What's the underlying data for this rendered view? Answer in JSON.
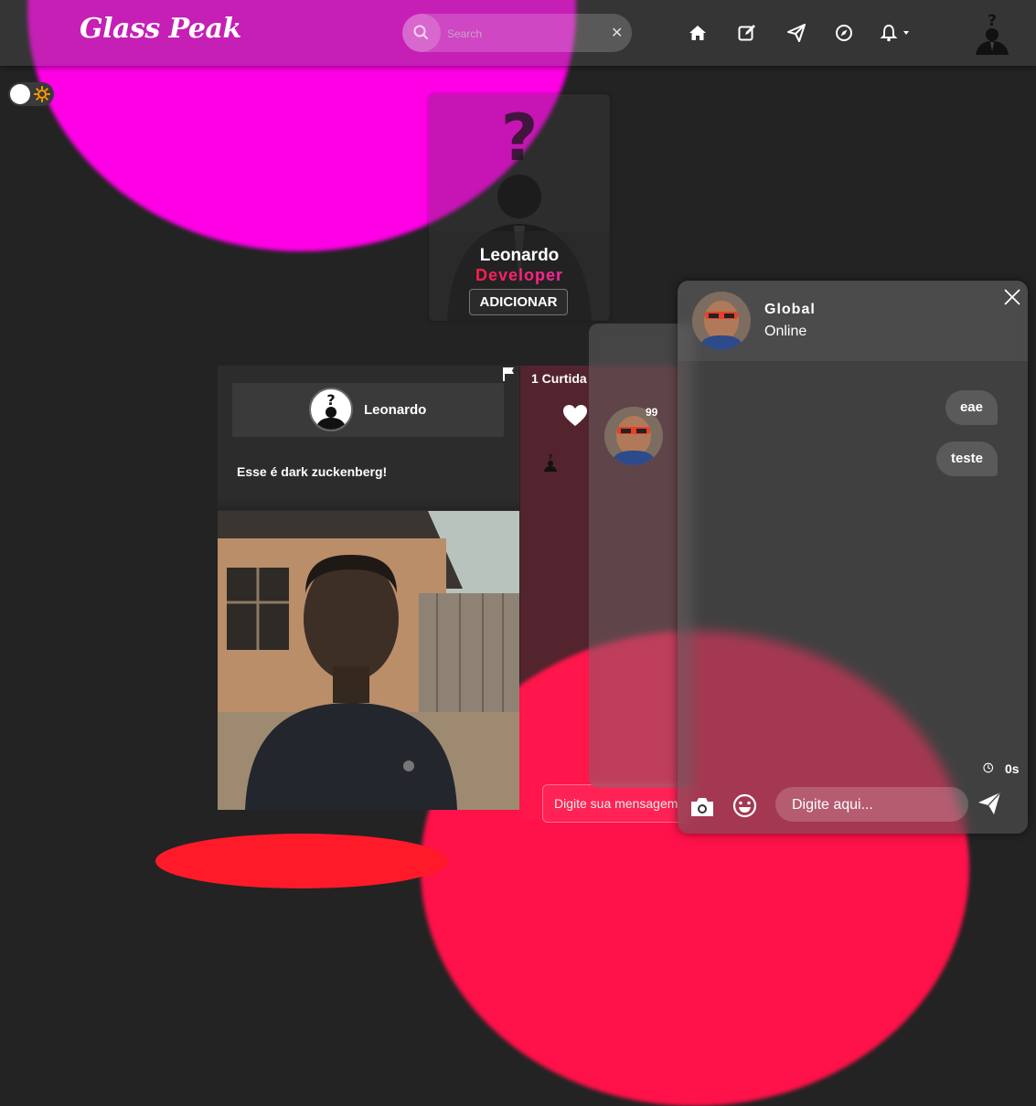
{
  "app": {
    "title": "Glass Peak"
  },
  "search": {
    "placeholder": "Search",
    "clear_icon": "close-icon"
  },
  "nav": {
    "icons": [
      "home-icon",
      "edit-icon",
      "send-icon",
      "compass-icon",
      "bell-icon"
    ]
  },
  "profile_card": {
    "name": "Leonardo",
    "role": "Developer",
    "add_label": "ADICIONAR"
  },
  "post": {
    "author": "Leonardo",
    "text": "Esse é dark zuckenberg!"
  },
  "comments": {
    "likes": "1 Curtida",
    "placeholder": "Digite sua mensagem"
  },
  "ghost": {
    "badge": "99"
  },
  "chat": {
    "title": "Global",
    "status": "Online",
    "messages": [
      "eae",
      "teste"
    ],
    "timer": "0s",
    "placeholder": "Digite aqui..."
  },
  "colors": {
    "accent_pink": "#ff00e6",
    "accent_red": "#ff1149",
    "background": "#232323"
  }
}
